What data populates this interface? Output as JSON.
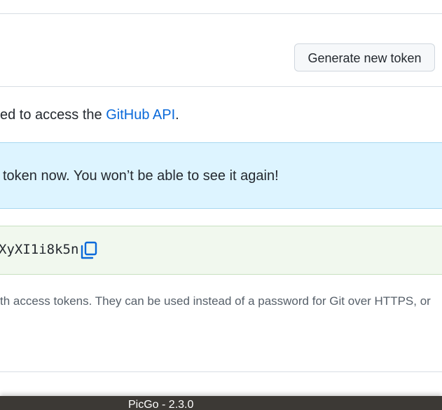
{
  "header": {
    "generate_button_label": "Generate new token"
  },
  "description": {
    "prefix": "ed to access the ",
    "link_text": "GitHub API",
    "suffix": "."
  },
  "flash": {
    "message": "token now. You won’t be able to see it again!"
  },
  "token": {
    "value": "XyXI1i8k5n",
    "copy_icon": "copy-icon"
  },
  "note": {
    "text": "th access tokens. They can be used instead of a password for Git over HTTPS, or"
  },
  "taskbar": {
    "app_title": "PicGo - 2.3.0"
  },
  "colors": {
    "link": "#0969da",
    "info_background": "#ddf4ff",
    "success_background": "#f1f8ee",
    "taskbar": "#3c3935"
  }
}
